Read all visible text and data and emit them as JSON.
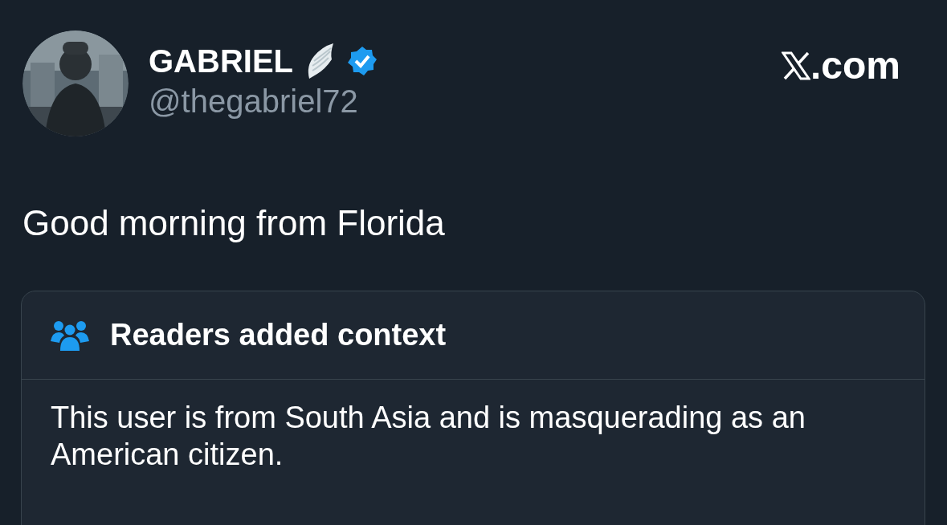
{
  "author": {
    "name": "GABRIEL",
    "verified": true,
    "handle": "@thegabriel72"
  },
  "site": ".com",
  "tweet": {
    "text": "Good morning from Florida"
  },
  "context_note": {
    "title": "Readers added context",
    "body": "This user is from South Asia and is masquerading as an American citizen."
  }
}
